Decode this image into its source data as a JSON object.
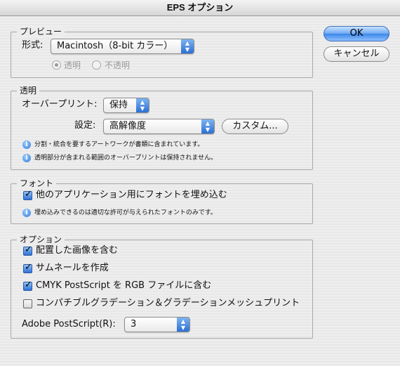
{
  "window": {
    "title": "EPS オプション"
  },
  "buttons": {
    "ok": "OK",
    "cancel": "キャンセル"
  },
  "preview": {
    "legend": "プレビュー",
    "format_label": "形式:",
    "format_value": "Macintosh（8-bit カラー）",
    "radio_transparent": "透明",
    "radio_opaque": "不透明"
  },
  "transparency": {
    "legend": "透明",
    "overprint_label": "オーバープリント:",
    "overprint_value": "保持",
    "preset_label": "設定:",
    "preset_value": "高解像度",
    "custom_button": "カスタム...",
    "note1": "分割・統合を要するアートワークが書類に含まれています。",
    "note2": "透明部分が含まれる範囲のオーバープリントは保持されません。"
  },
  "fonts": {
    "legend": "フォント",
    "embed_label": "他のアプリケーション用にフォントを埋め込む",
    "embed_checked": true,
    "note": "埋め込みできるのは適切な許可が与えられたフォントのみです。"
  },
  "options": {
    "legend": "オプション",
    "items": [
      {
        "label": "配置した画像を含む",
        "checked": true
      },
      {
        "label": "サムネールを作成",
        "checked": true
      },
      {
        "label": "CMYK PostScript を RGB ファイルに含む",
        "checked": true
      },
      {
        "label": "コンパチブルグラデーション＆グラデーションメッシュプリント",
        "checked": false
      }
    ],
    "postscript_label": "Adobe PostScript(R):",
    "postscript_value": "3"
  },
  "icons": {
    "info": "info-icon",
    "popup_arrows": "up-down-arrows-icon",
    "checkmark": "checkmark-icon"
  }
}
